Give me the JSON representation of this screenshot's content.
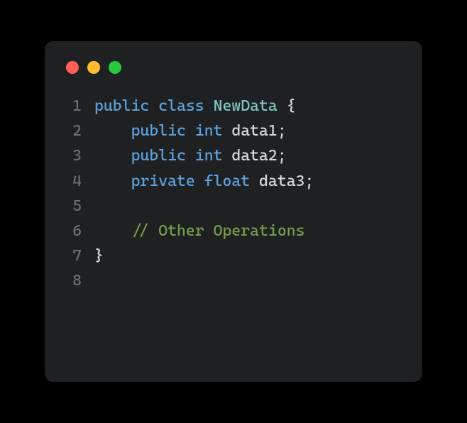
{
  "window": {
    "traffic_lights": {
      "close": "red",
      "minimize": "yellow",
      "zoom": "green"
    }
  },
  "code": {
    "gutter": [
      "1",
      "2",
      "3",
      "4",
      "5",
      "6",
      "7",
      "8"
    ],
    "lines": {
      "l1": {
        "kw1": "public",
        "kw2": "class",
        "cls": "NewData",
        "brace": " {"
      },
      "l2": {
        "indent": "    ",
        "kw1": "public",
        "kw2": "int",
        "ident": "data1",
        "semi": ";"
      },
      "l3": {
        "indent": "    ",
        "kw1": "public",
        "kw2": "int",
        "ident": "data2",
        "semi": ";"
      },
      "l4": {
        "indent": "    ",
        "kw1": "private",
        "kw2": "float",
        "ident": "data3",
        "semi": ";"
      },
      "l5": {
        "blank": ""
      },
      "l6": {
        "indent": "    ",
        "comment": "// Other Operations"
      },
      "l7": {
        "brace": "}"
      },
      "l8": {
        "blank": ""
      }
    }
  }
}
